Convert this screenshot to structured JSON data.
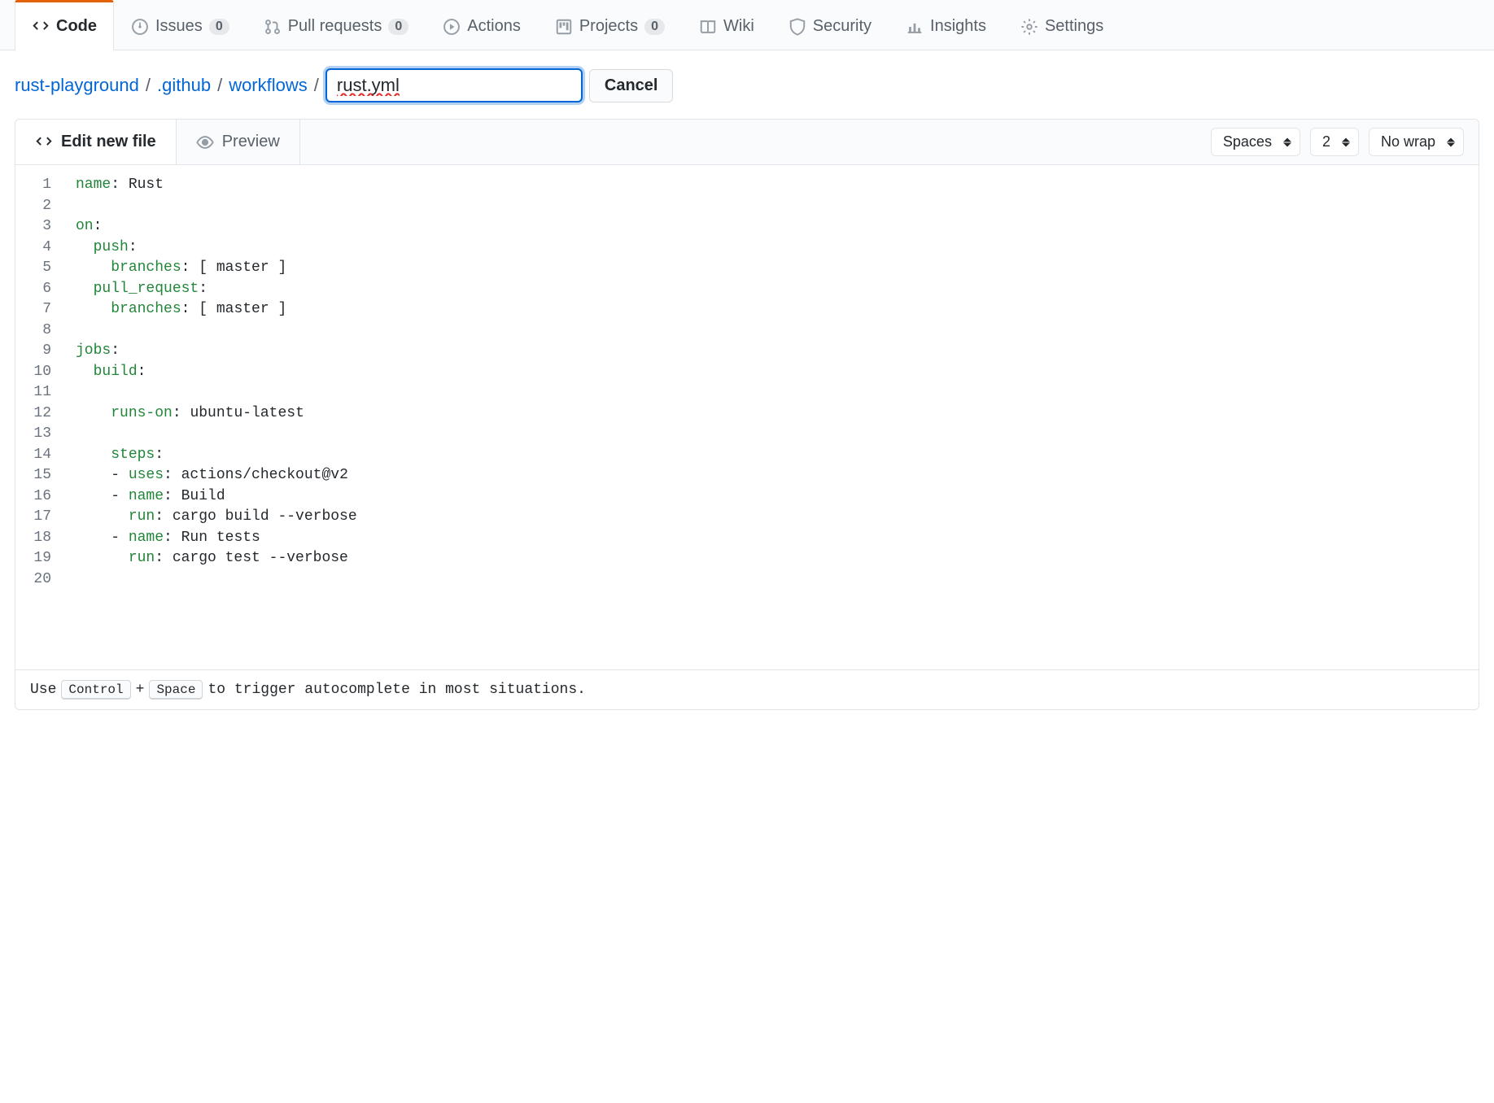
{
  "nav": {
    "tabs": [
      {
        "label": "Code",
        "selected": true
      },
      {
        "label": "Issues",
        "count": "0"
      },
      {
        "label": "Pull requests",
        "count": "0"
      },
      {
        "label": "Actions"
      },
      {
        "label": "Projects",
        "count": "0"
      },
      {
        "label": "Wiki"
      },
      {
        "label": "Security"
      },
      {
        "label": "Insights"
      },
      {
        "label": "Settings"
      }
    ]
  },
  "breadcrumb": {
    "repo": "rust-playground",
    "parts": [
      ".github",
      "workflows"
    ],
    "sep": "/",
    "filename": "rust.yml",
    "cancel": "Cancel"
  },
  "editor_tabs": {
    "edit": "Edit new file",
    "preview": "Preview"
  },
  "toolbar": {
    "indent": "Spaces",
    "indent_size": "2",
    "wrap": "No wrap"
  },
  "code": {
    "lines": [
      [
        {
          "t": "name",
          "c": "ent"
        },
        {
          "t": ": Rust",
          "c": ""
        }
      ],
      [],
      [
        {
          "t": "on",
          "c": "ent"
        },
        {
          "t": ":",
          "c": ""
        }
      ],
      [
        {
          "t": "  ",
          "c": ""
        },
        {
          "t": "push",
          "c": "ent"
        },
        {
          "t": ":",
          "c": ""
        }
      ],
      [
        {
          "t": "    ",
          "c": ""
        },
        {
          "t": "branches",
          "c": "ent"
        },
        {
          "t": ": [ master ]",
          "c": ""
        }
      ],
      [
        {
          "t": "  ",
          "c": ""
        },
        {
          "t": "pull_request",
          "c": "ent"
        },
        {
          "t": ":",
          "c": ""
        }
      ],
      [
        {
          "t": "    ",
          "c": ""
        },
        {
          "t": "branches",
          "c": "ent"
        },
        {
          "t": ": [ master ]",
          "c": ""
        }
      ],
      [],
      [
        {
          "t": "jobs",
          "c": "ent"
        },
        {
          "t": ":",
          "c": ""
        }
      ],
      [
        {
          "t": "  ",
          "c": ""
        },
        {
          "t": "build",
          "c": "ent"
        },
        {
          "t": ":",
          "c": ""
        }
      ],
      [],
      [
        {
          "t": "    ",
          "c": ""
        },
        {
          "t": "runs-on",
          "c": "ent"
        },
        {
          "t": ": ubuntu-latest",
          "c": ""
        }
      ],
      [],
      [
        {
          "t": "    ",
          "c": ""
        },
        {
          "t": "steps",
          "c": "ent"
        },
        {
          "t": ":",
          "c": ""
        }
      ],
      [
        {
          "t": "    - ",
          "c": ""
        },
        {
          "t": "uses",
          "c": "ent"
        },
        {
          "t": ": actions/checkout@v2",
          "c": ""
        }
      ],
      [
        {
          "t": "    - ",
          "c": ""
        },
        {
          "t": "name",
          "c": "ent"
        },
        {
          "t": ": Build",
          "c": ""
        }
      ],
      [
        {
          "t": "      ",
          "c": ""
        },
        {
          "t": "run",
          "c": "ent"
        },
        {
          "t": ": cargo build --verbose",
          "c": ""
        }
      ],
      [
        {
          "t": "    - ",
          "c": ""
        },
        {
          "t": "name",
          "c": "ent"
        },
        {
          "t": ": Run tests",
          "c": ""
        }
      ],
      [
        {
          "t": "      ",
          "c": ""
        },
        {
          "t": "run",
          "c": "ent"
        },
        {
          "t": ": cargo test --verbose",
          "c": ""
        }
      ],
      []
    ]
  },
  "hint": {
    "prefix": "Use ",
    "kbd1": "Control",
    "plus": " + ",
    "kbd2": "Space",
    "suffix": " to trigger autocomplete in most situations."
  }
}
